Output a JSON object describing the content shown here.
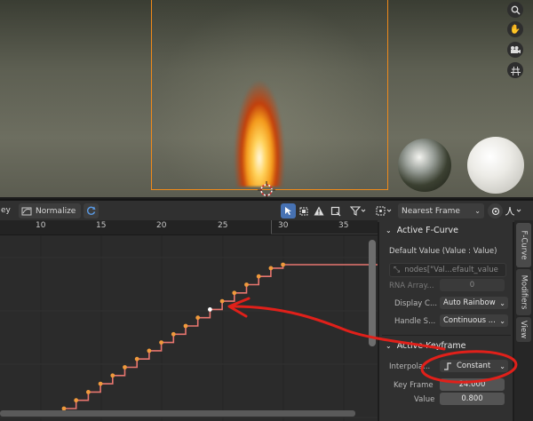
{
  "viewport": {
    "nav_icons": [
      "zoom-icon",
      "hand-icon",
      "camera-icon",
      "grid-icon"
    ]
  },
  "header": {
    "left_fragment": "ey",
    "normalize_label": "Normalize",
    "snap_mode": "Nearest Frame"
  },
  "graph": {
    "ruler_ticks": [
      "10",
      "15",
      "20",
      "25",
      "30",
      "35"
    ],
    "curve_color": "#e8766f",
    "keyframe_color": "#f09a3c",
    "selected_keyframe_color": "#ffffff",
    "annotation_color": "#e0201a"
  },
  "sidebar": {
    "active_fcurve": {
      "title": "Active F-Curve",
      "default_value_label": "Default Value (Value : Value)",
      "data_path": "nodes[\"Val...efault_value",
      "rna_array_label": "RNA Array...",
      "rna_array_value": "0",
      "display_color_label": "Display C...",
      "display_color_value": "Auto Rainbow",
      "handle_smoothing_label": "Handle S...",
      "handle_smoothing_value": "Continuous ..."
    },
    "active_keyframe": {
      "title": "Active Keyframe",
      "interpolation_label": "Interpola...",
      "interpolation_value": "Constant",
      "key_frame_label": "Key Frame",
      "key_frame_value": "24.000",
      "value_label": "Value",
      "value_value": "0.800"
    },
    "tabs": [
      "F-Curve",
      "Modifiers",
      "View"
    ]
  }
}
